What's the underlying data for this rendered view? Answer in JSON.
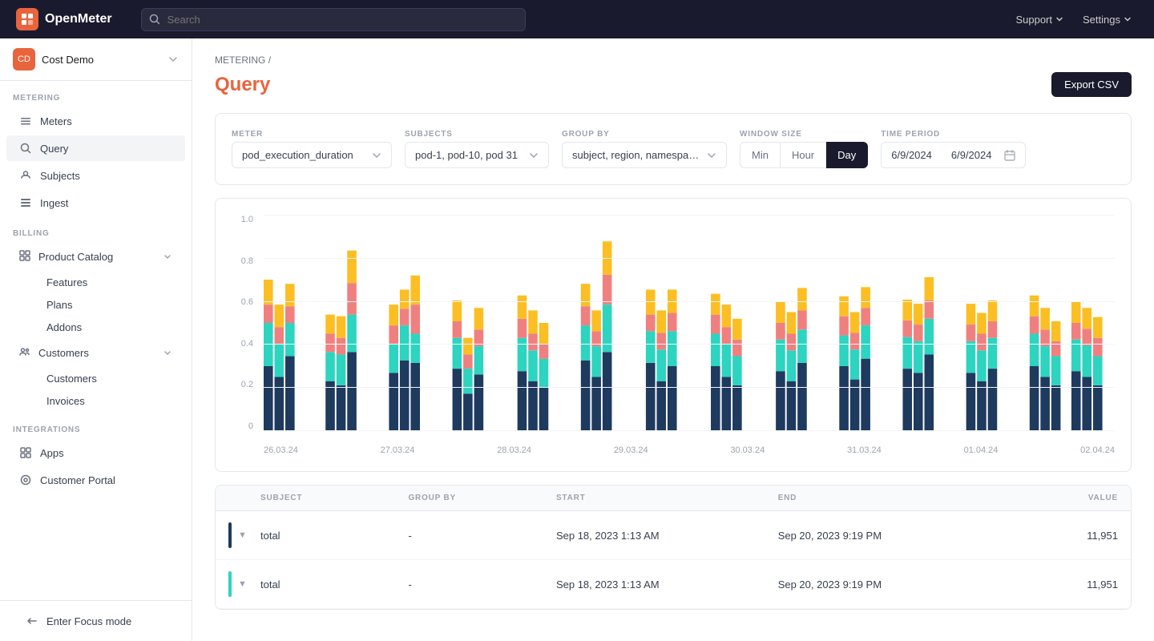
{
  "topnav": {
    "logo_text": "OpenMeter",
    "search_placeholder": "Search",
    "support_label": "Support",
    "settings_label": "Settings"
  },
  "sidebar": {
    "org_name": "Cost Demo",
    "sections": {
      "metering_label": "METERING",
      "billing_label": "BILLING",
      "integrations_label": "INTEGRATIONS"
    },
    "metering_items": [
      {
        "id": "meters",
        "label": "Meters"
      },
      {
        "id": "query",
        "label": "Query",
        "active": true
      },
      {
        "id": "subjects",
        "label": "Subjects"
      },
      {
        "id": "ingest",
        "label": "Ingest"
      }
    ],
    "billing_items": [
      {
        "id": "product-catalog",
        "label": "Product Catalog",
        "expandable": true
      },
      {
        "id": "features",
        "label": "Features",
        "sub": true
      },
      {
        "id": "plans",
        "label": "Plans",
        "sub": true
      },
      {
        "id": "addons",
        "label": "Addons",
        "sub": true
      },
      {
        "id": "customers",
        "label": "Customers",
        "expandable": true
      },
      {
        "id": "customers-sub",
        "label": "Customers",
        "sub": true
      },
      {
        "id": "invoices",
        "label": "Invoices",
        "sub": true
      }
    ],
    "integration_items": [
      {
        "id": "apps",
        "label": "Apps"
      },
      {
        "id": "customer-portal",
        "label": "Customer Portal"
      }
    ],
    "bottom": {
      "focus_mode_label": "Enter Focus mode"
    }
  },
  "breadcrumb": {
    "parent": "METERING",
    "separator": "/",
    "current": ""
  },
  "page": {
    "title": "Query",
    "export_btn": "Export CSV"
  },
  "query_controls": {
    "meter_label": "METER",
    "meter_value": "pod_execution_duration",
    "subjects_label": "SUBJECTS",
    "subjects_value": "pod-1, pod-10, pod 31",
    "group_by_label": "GROUP BY",
    "group_by_value": "subject, region, namespace, lo",
    "window_size_label": "WINDOW SIZE",
    "window_options": [
      "Min",
      "Hour",
      "Day"
    ],
    "window_active": "Day",
    "time_period_label": "TIME PERIOD",
    "time_start": "6/9/2024",
    "time_end": "6/9/2024"
  },
  "chart": {
    "y_labels": [
      "1.0",
      "0.8",
      "0.6",
      "0.4",
      "0.2",
      "0"
    ],
    "x_labels": [
      "26.03.24",
      "27.03.24",
      "28.03.24",
      "29.03.24",
      "30.03.24",
      "31.03.24",
      "01.04.24",
      "02.04.24"
    ],
    "colors": {
      "dark_blue": "#1e3a5f",
      "teal": "#2dd4bf",
      "salmon": "#f08080",
      "yellow": "#fbbf24"
    }
  },
  "table": {
    "columns": [
      "",
      "SUBJECT",
      "GROUP BY",
      "START",
      "END",
      "VALUE"
    ],
    "rows": [
      {
        "expand": "▼",
        "subject": "total",
        "group_by": "-",
        "start": "Sep 18, 2023 1:13 AM",
        "end": "Sep 20, 2023 9:19 PM",
        "value": "11,951",
        "indicator_color": "#1e3a5f"
      },
      {
        "expand": "▼",
        "subject": "total",
        "group_by": "-",
        "start": "Sep 18, 2023 1:13 AM",
        "end": "Sep 20, 2023 9:19 PM",
        "value": "11,951",
        "indicator_color": "#2dd4bf"
      }
    ]
  }
}
